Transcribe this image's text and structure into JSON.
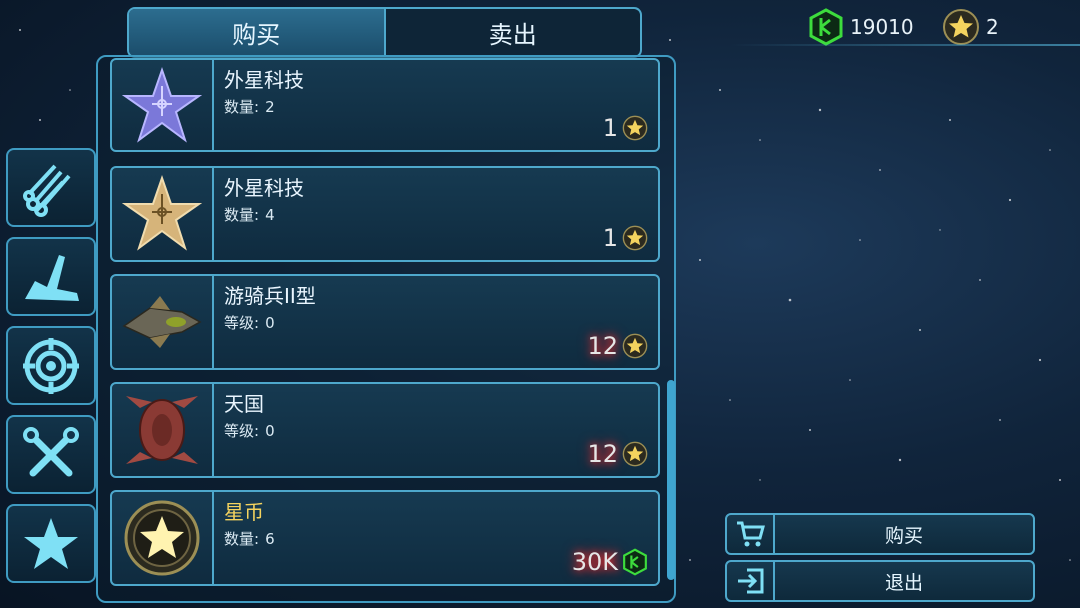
{
  "tabs": [
    {
      "label": "购买",
      "active": true
    },
    {
      "label": "卖出",
      "active": false
    }
  ],
  "currency": {
    "gems": "19010",
    "stars": "2",
    "gem_icon": "green-hex-gem-icon",
    "star_icon": "gold-star-coin-icon"
  },
  "sidebar": [
    {
      "icon": "pipes-icon"
    },
    {
      "icon": "hull-icon"
    },
    {
      "icon": "target-icon"
    },
    {
      "icon": "tools-icon"
    },
    {
      "icon": "star-icon"
    }
  ],
  "items": [
    {
      "name": "外星科技",
      "sub_label": "数量:",
      "sub_value": "2",
      "price": "1",
      "currency": "star",
      "highlight": false
    },
    {
      "name": "外星科技",
      "sub_label": "数量:",
      "sub_value": "4",
      "price": "1",
      "currency": "star",
      "highlight": false
    },
    {
      "name": "游骑兵II型",
      "sub_label": "等级:",
      "sub_value": "0",
      "price": "12",
      "currency": "star",
      "highlight": true
    },
    {
      "name": "天国",
      "sub_label": "等级:",
      "sub_value": "0",
      "price": "12",
      "currency": "star",
      "highlight": true
    },
    {
      "name": "星币",
      "sub_label": "数量:",
      "sub_value": "6",
      "price": "30K",
      "currency": "gem",
      "highlight": true
    }
  ],
  "actions": {
    "buy_label": "购买",
    "exit_label": "退出"
  },
  "colors": {
    "accent": "#4ea8cc",
    "gem": "#3ddc3d",
    "star_gold": "#f4d35e",
    "warning_glow": "#ff2a2a"
  }
}
